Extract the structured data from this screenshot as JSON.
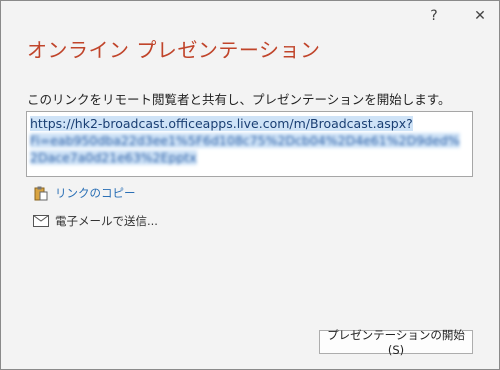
{
  "window": {
    "help_label": "?",
    "close_label": "✕"
  },
  "dialog": {
    "title": "オンライン プレゼンテーション",
    "description": "このリンクをリモート閲覧者と共有し、プレゼンテーションを開始します。",
    "link": {
      "line1": "https://hk2-broadcast.officeapps.live.com/m/Broadcast.aspx?",
      "line2_obscured": "Fi=eab950dba22d3ee1%5F6d108c75%2Dcb04%2D4e61%2D9ded%",
      "line3_obscured": "2Dace7a0d21e63%2Epptx"
    },
    "actions": {
      "copy_label": "リンクのコピー",
      "email_label": "電子メールで送信..."
    },
    "start_button_label": "プレゼンテーションの開始(S)",
    "icons": {
      "copy": "clipboard-icon",
      "email": "envelope-icon"
    },
    "colors": {
      "title": "#c0442a",
      "link_action": "#2a6fb5",
      "selection": "#cfe3f7"
    }
  }
}
